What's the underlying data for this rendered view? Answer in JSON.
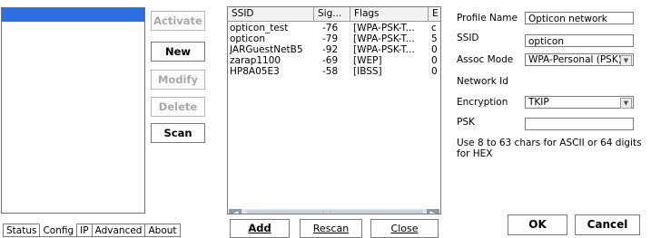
{
  "config_screen": {
    "buttons": {
      "activate": "Activate",
      "new": "New",
      "modify": "Modify",
      "delete": "Delete",
      "scan": "Scan"
    },
    "tabs": [
      "Status",
      "Config",
      "IP",
      "Advanced",
      "About"
    ],
    "active_tab": "Config"
  },
  "scan_screen": {
    "columns": [
      "SSID",
      "Sig...",
      "Flags",
      "E"
    ],
    "rows": [
      {
        "ssid": "opticon_test",
        "signal": "-76",
        "flags": "[WPA-PSK-T...",
        "extra": "c"
      },
      {
        "ssid": "opticon",
        "signal": "-79",
        "flags": "[WPA-PSK-T...",
        "extra": "5"
      },
      {
        "ssid": "JARGuestNetB5",
        "signal": "-92",
        "flags": "[WPA-PSK-T...",
        "extra": "0"
      },
      {
        "ssid": "zarap1100",
        "signal": "-69",
        "flags": "[WEP]",
        "extra": "0"
      },
      {
        "ssid": "HP8A05E3",
        "signal": "-58",
        "flags": "[IBSS]",
        "extra": "0"
      }
    ],
    "buttons": {
      "add": "Add",
      "rescan": "Rescan",
      "close": "Close"
    }
  },
  "profile_screen": {
    "labels": {
      "profile_name": "Profile Name",
      "ssid": "SSID",
      "assoc_mode": "Assoc Mode",
      "network_id": "Network Id",
      "encryption": "Encryption",
      "psk": "PSK"
    },
    "values": {
      "profile_name": "Opticon network",
      "ssid": "opticon",
      "assoc_mode": "WPA-Personal (PSK)",
      "encryption": "TKIP",
      "psk": ""
    },
    "hint": "Use 8 to 63 chars for ASCII or 64 digits for HEX",
    "buttons": {
      "ok": "OK",
      "cancel": "Cancel"
    }
  },
  "colors": {
    "selection": "#2d6fe0",
    "scrollbar_arrow": "#8b98ab",
    "disabled_text": "#a8a8a8"
  }
}
